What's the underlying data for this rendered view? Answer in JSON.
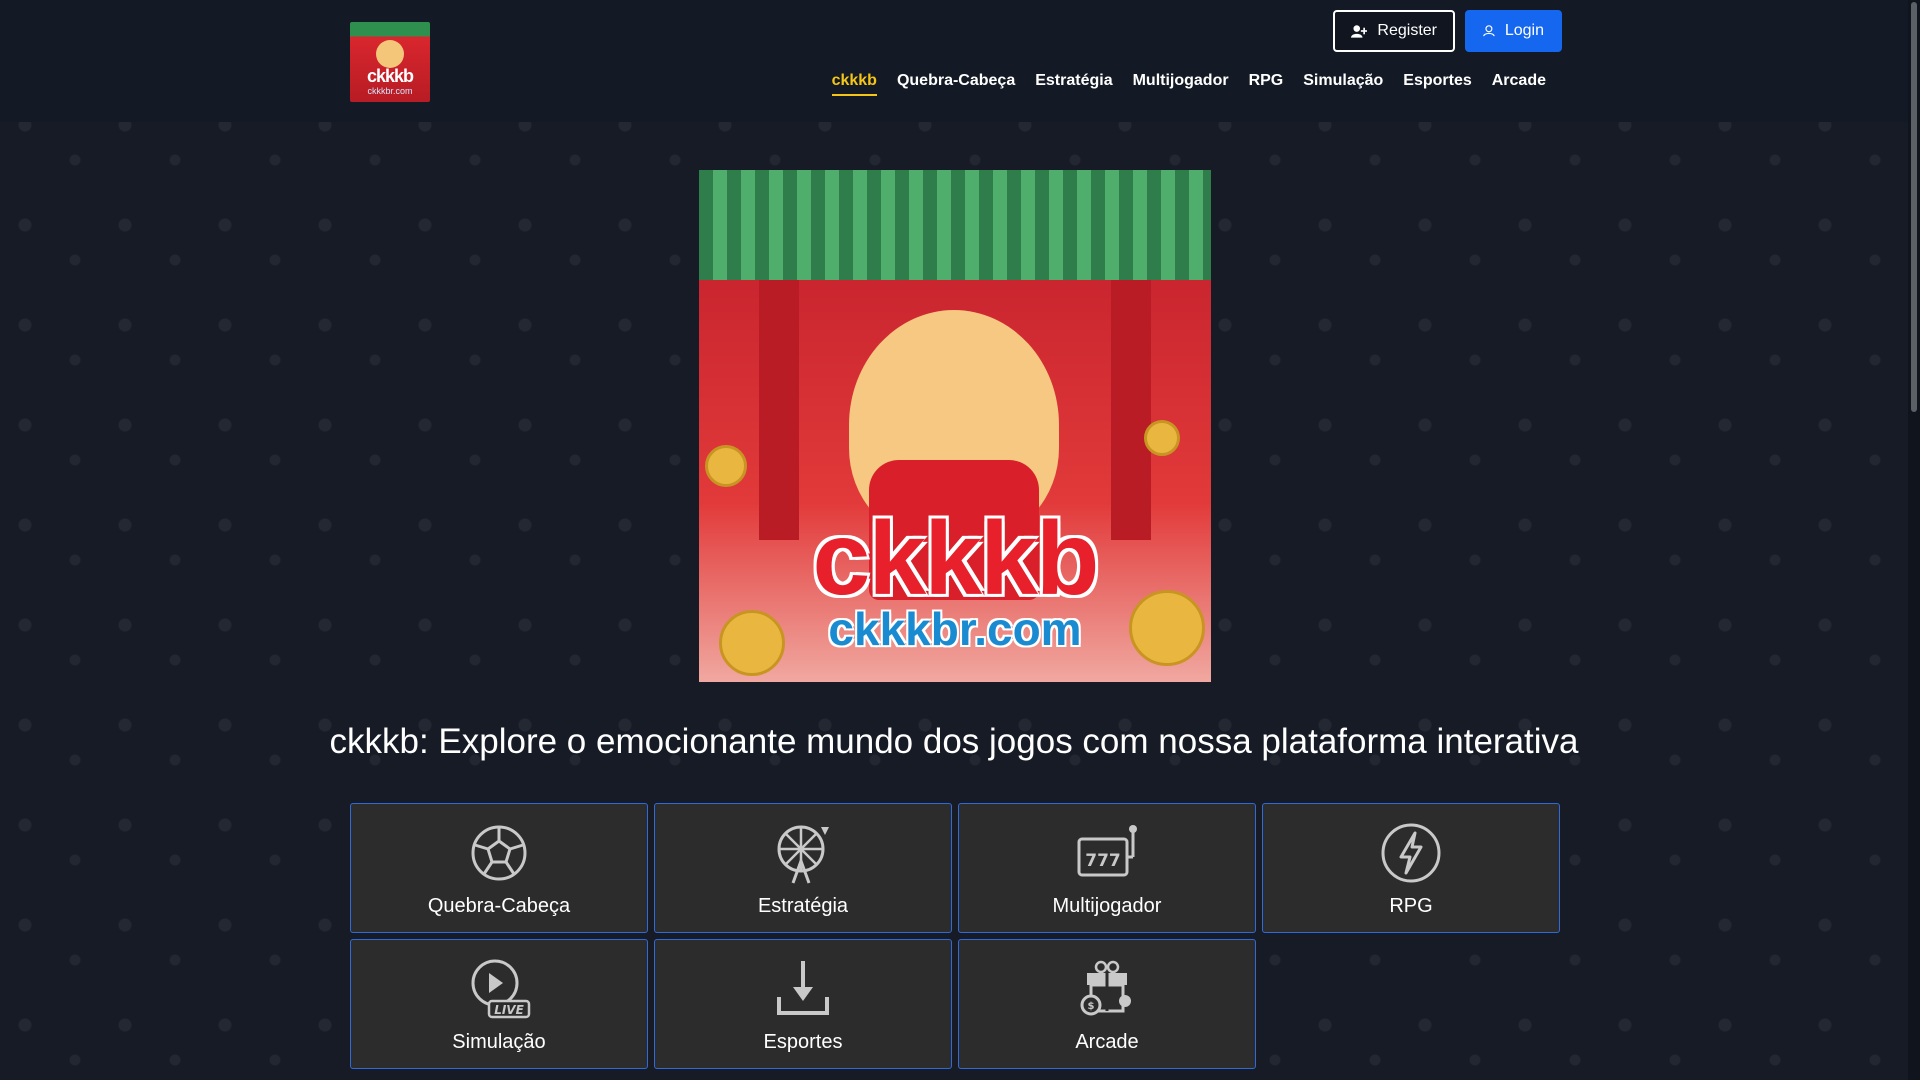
{
  "header": {
    "logo": {
      "brand": "ckkkb",
      "domain": "ckkkbr.com"
    },
    "register_label": "Register",
    "login_label": "Login",
    "nav": [
      "ckkkb",
      "Quebra-Cabeça",
      "Estratégia",
      "Multijogador",
      "RPG",
      "Simulação",
      "Esportes",
      "Arcade"
    ],
    "active_nav": "ckkkb"
  },
  "hero": {
    "brand": "ckkkb",
    "domain": "ckkkbr.com"
  },
  "main": {
    "headline": "ckkkb: Explore o emocionante mundo dos jogos com nossa plataforma interativa",
    "categories": [
      {
        "label": "Quebra-Cabeça",
        "icon": "soccer-ball-icon"
      },
      {
        "label": "Estratégia",
        "icon": "ferris-wheel-icon"
      },
      {
        "label": "Multijogador",
        "icon": "slot-machine-icon"
      },
      {
        "label": "RPG",
        "icon": "lightning-icon"
      },
      {
        "label": "Simulação",
        "icon": "live-play-icon"
      },
      {
        "label": "Esportes",
        "icon": "download-icon"
      },
      {
        "label": "Arcade",
        "icon": "gift-chips-icon"
      }
    ]
  },
  "colors": {
    "background": "#161b26",
    "header": "#131a25",
    "accent_active": "#f5c518",
    "login": "#1667f0",
    "tile": "#2c2c2c",
    "tile_border": "#2f6ad8"
  }
}
